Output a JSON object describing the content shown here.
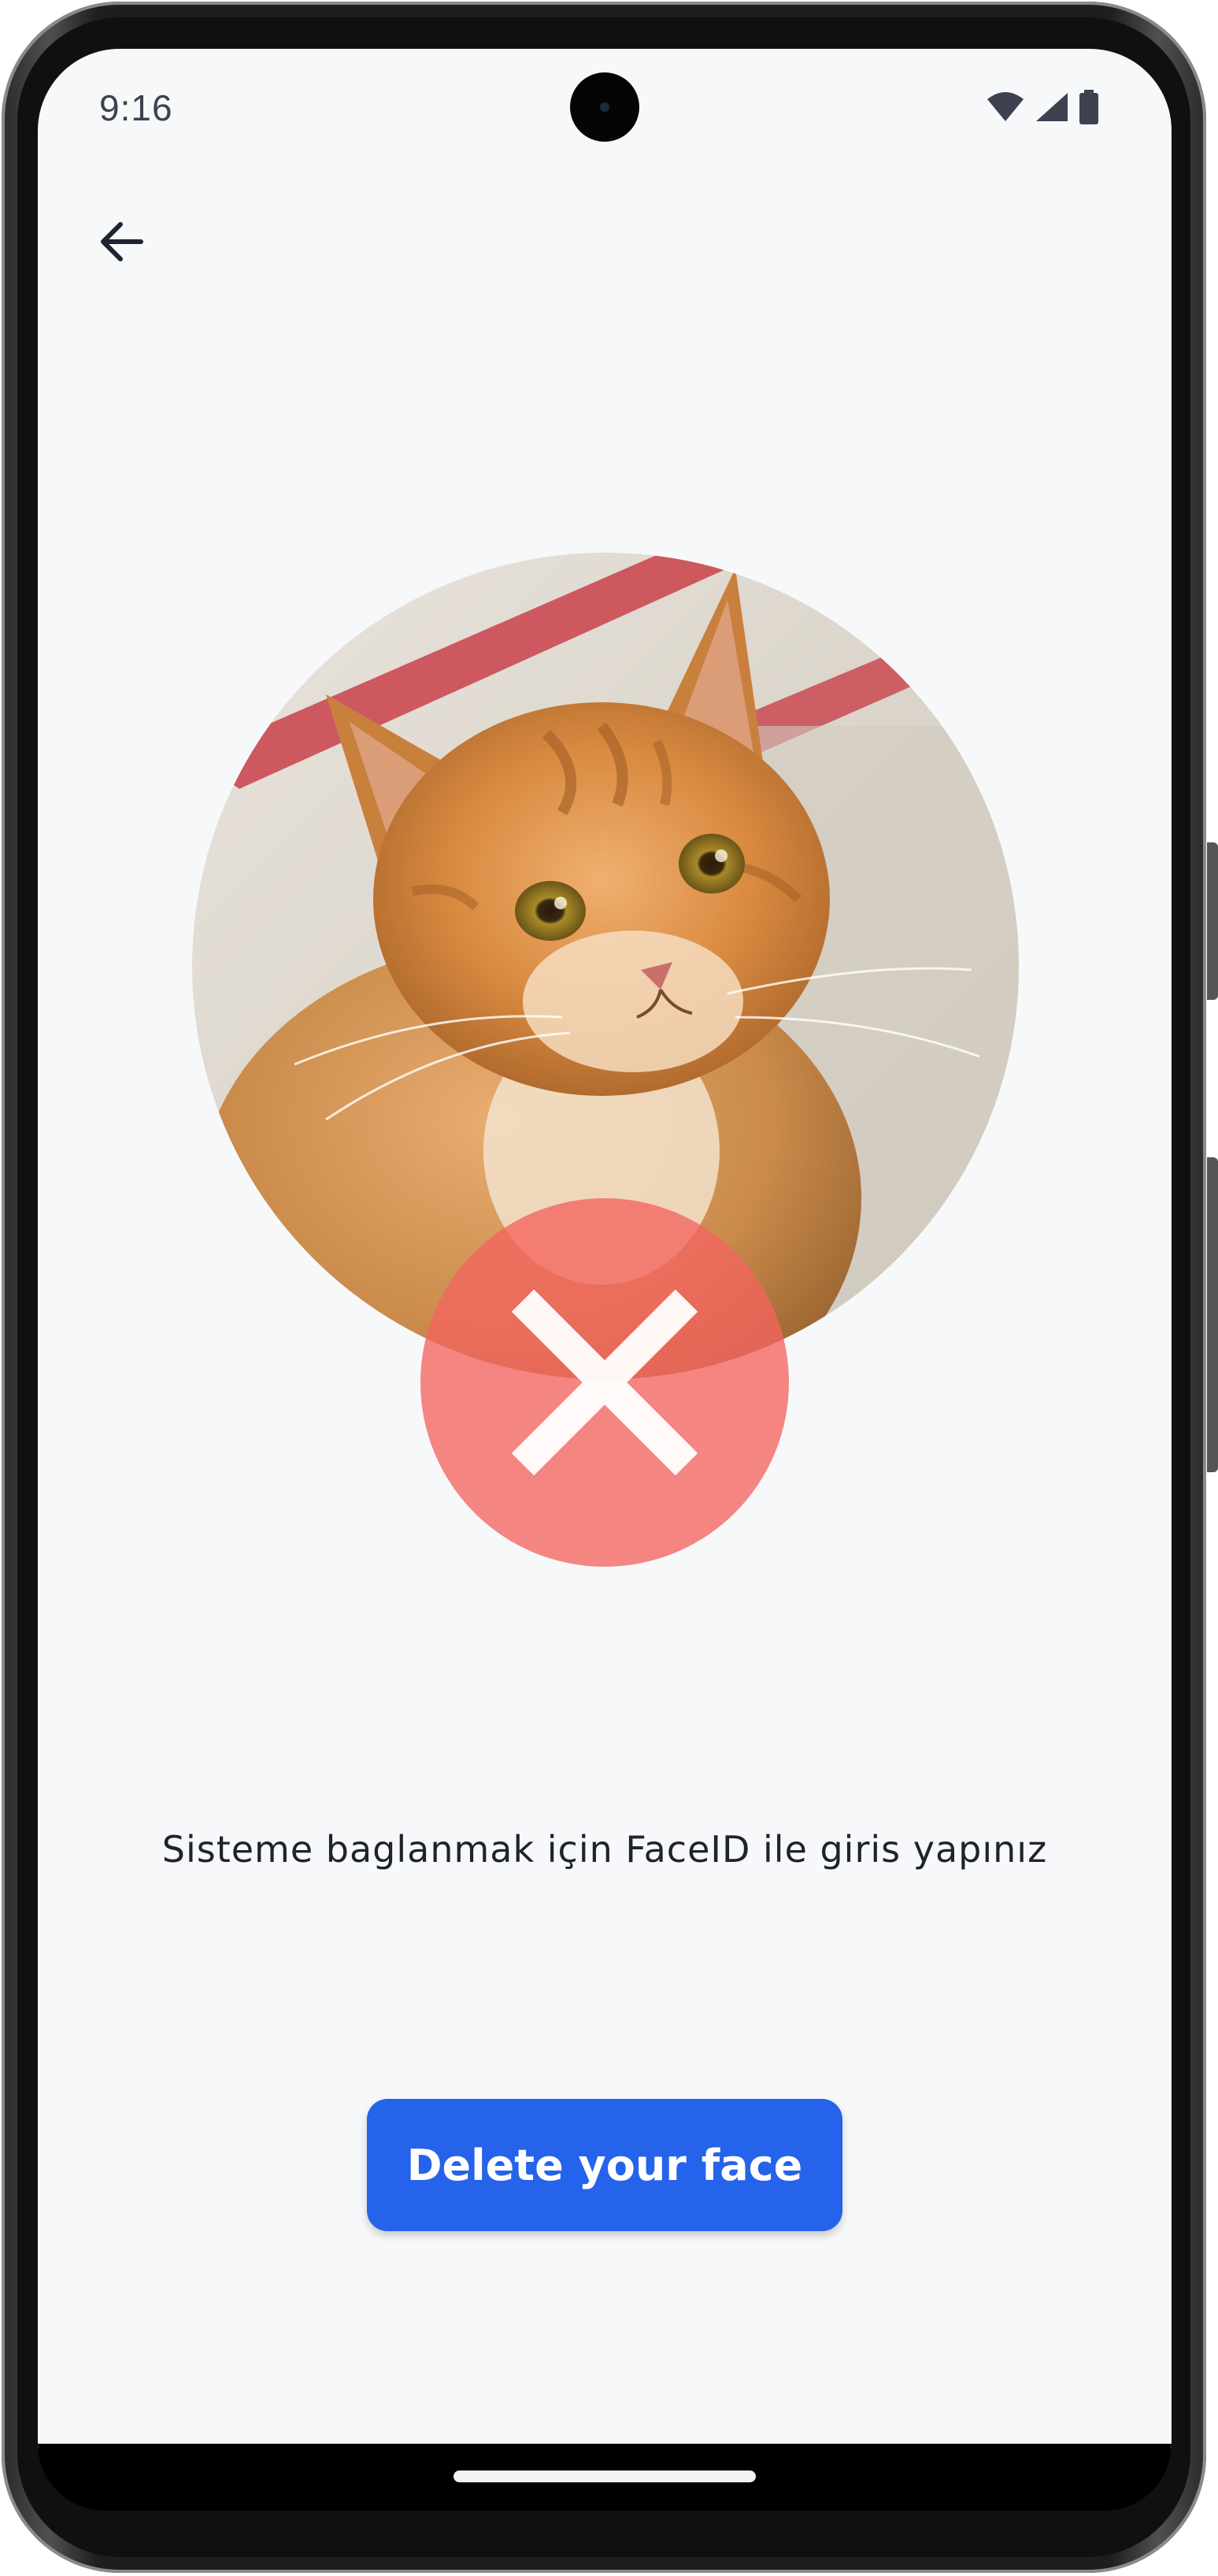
{
  "status_bar": {
    "time": "9:16",
    "icons": [
      "wifi-icon",
      "cell-signal-icon",
      "battery-icon"
    ]
  },
  "header": {
    "back_icon": "arrow-left-icon"
  },
  "face_preview": {
    "image": "orange-tabby-cat-photo",
    "status_icon": "close-icon",
    "status_color": "#f3645f"
  },
  "main": {
    "instruction": "Sisteme baglanmak için FaceID ile giris yapınız",
    "delete_button_label": "Delete your face"
  },
  "colors": {
    "background": "#f7f8fa",
    "primary": "#2563eb",
    "error": "#f3645f",
    "text": "#20232e"
  }
}
